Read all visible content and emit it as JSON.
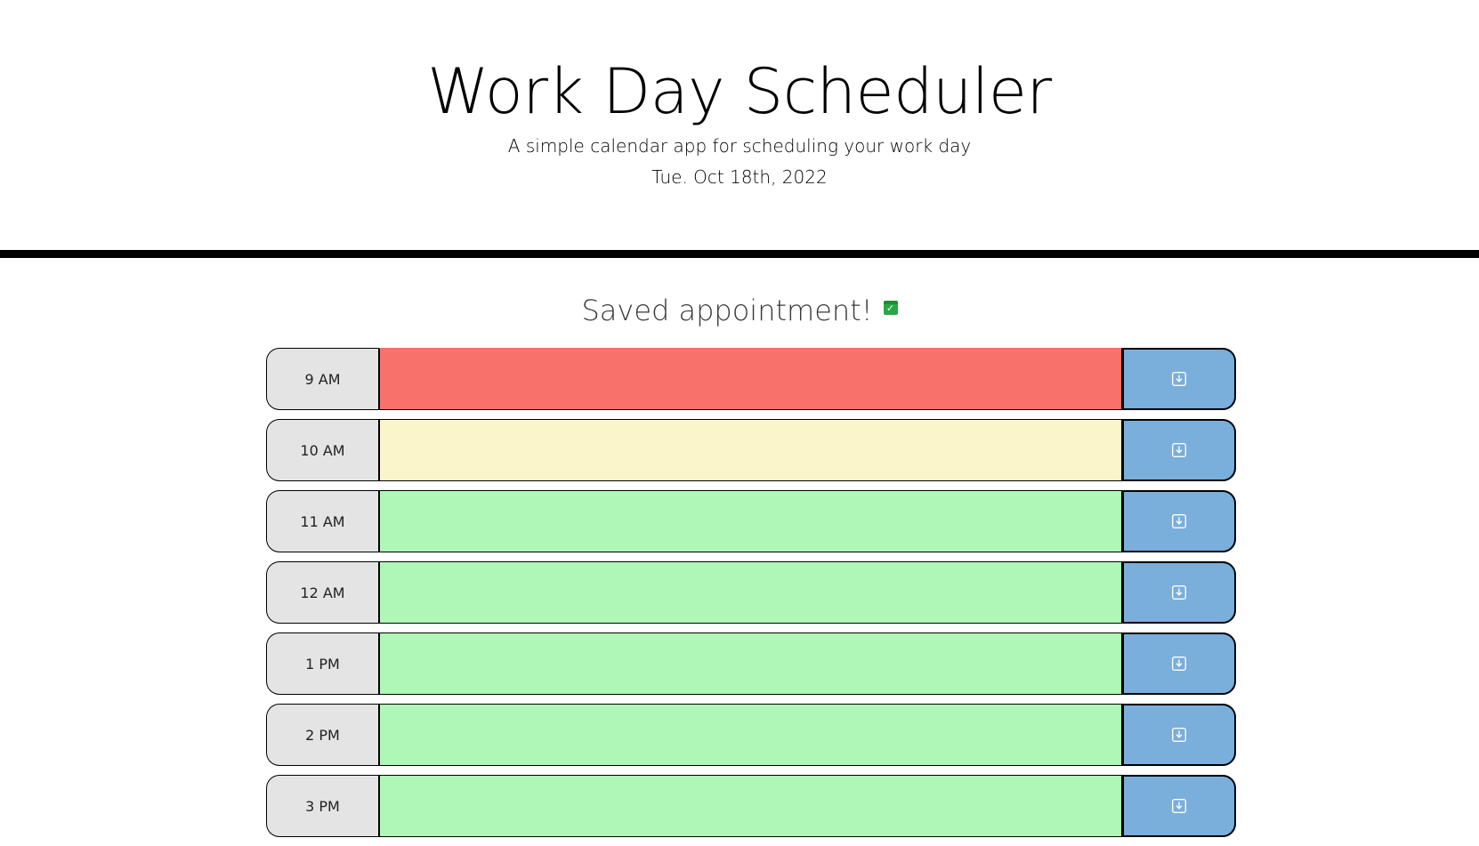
{
  "header": {
    "title": "Work Day Scheduler",
    "subtitle": "A simple calendar app for scheduling your work day",
    "current_day": "Tue. Oct 18th, 2022"
  },
  "status": {
    "message": "Saved appointment!",
    "icon": "calendar-check-icon"
  },
  "colors": {
    "past": "#f8716a",
    "present": "#fbf5cc",
    "future": "#aff7b7",
    "save_button": "#7aaedb",
    "hour_label_bg": "#e4e4e4"
  },
  "time_blocks": [
    {
      "hour": "9 AM",
      "state": "past",
      "text": ""
    },
    {
      "hour": "10 AM",
      "state": "present",
      "text": ""
    },
    {
      "hour": "11 AM",
      "state": "future",
      "text": ""
    },
    {
      "hour": "12 AM",
      "state": "future",
      "text": ""
    },
    {
      "hour": "1 PM",
      "state": "future",
      "text": ""
    },
    {
      "hour": "2 PM",
      "state": "future",
      "text": ""
    },
    {
      "hour": "3 PM",
      "state": "future",
      "text": ""
    }
  ],
  "save_icon": "save-icon"
}
